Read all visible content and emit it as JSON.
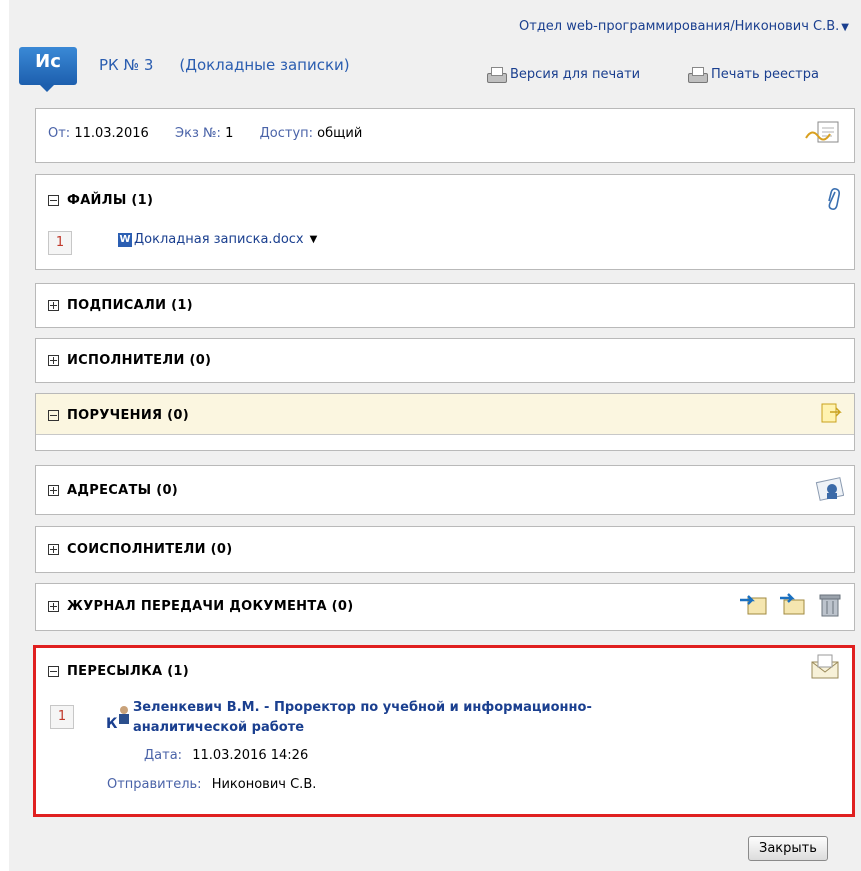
{
  "header": {
    "user_department": "Отдел web-программирования/Никонович С.В.",
    "logo_text": "Ис",
    "rk_number": "РК № 3",
    "rk_type": "(Докладные записки)",
    "print_version": "Версия для печати",
    "print_registry": "Печать реестра"
  },
  "info": {
    "from_label": "От:",
    "from_value": "11.03.2016",
    "copy_label": "Экз №:",
    "copy_value": "1",
    "access_label": "Доступ:",
    "access_value": "общий"
  },
  "files": {
    "title": "ФАЙЛЫ (1)",
    "items": [
      {
        "num": "1",
        "name": "Докладная записка.docx"
      }
    ]
  },
  "sections": {
    "signed": "ПОДПИСАЛИ (1)",
    "executors": "ИСПОЛНИТЕЛИ (0)",
    "assignments": "ПОРУЧЕНИЯ (0)",
    "addressees": "АДРЕСАТЫ (0)",
    "coexecutors": "СОИСПОЛНИТЕЛИ (0)",
    "transfer_log": "ЖУРНАЛ ПЕРЕДАЧИ ДОКУМЕНТА (0)"
  },
  "forwarding": {
    "title": "ПЕРЕСЫЛКА (1)",
    "items": [
      {
        "num": "1",
        "recipient_line1": "Зеленкевич В.М. - Проректор по учебной и информационно-",
        "recipient_line2": "аналитической работе",
        "date_label": "Дата:",
        "date_value": "11.03.2016 14:26",
        "sender_label": "Отправитель:",
        "sender_value": "Никонович С.В."
      }
    ]
  },
  "footer": {
    "close_label": "Закрыть"
  },
  "colors": {
    "link": "#1a3f8f",
    "highlight_border": "#e02020",
    "yellow_panel": "#fbf6e0"
  }
}
